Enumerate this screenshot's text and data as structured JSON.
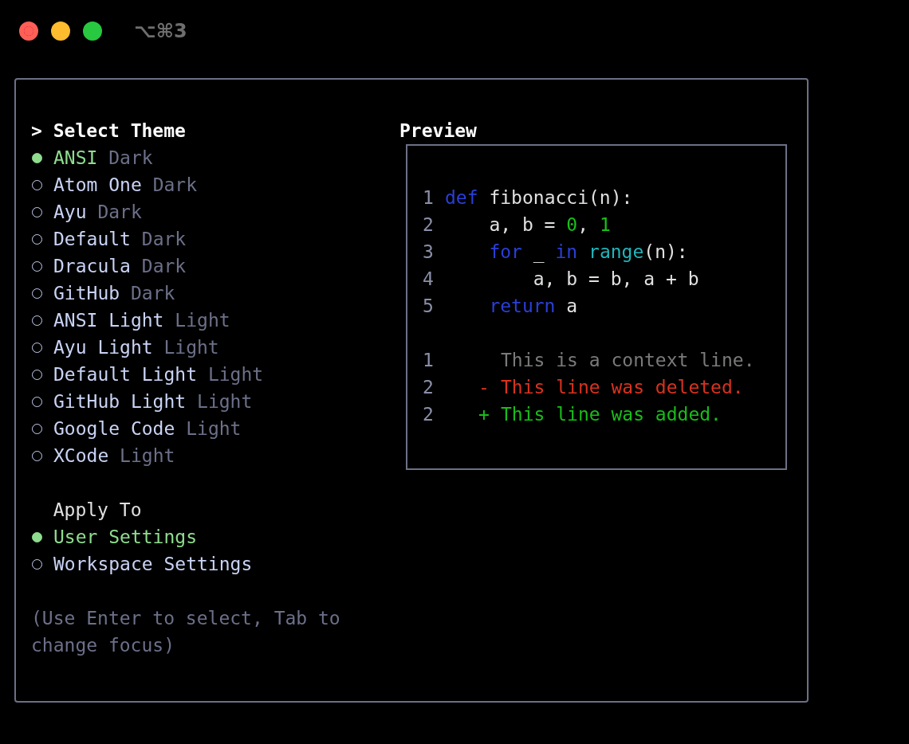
{
  "window": {
    "title": "⌥⌘3"
  },
  "theme_section": {
    "marker": ">",
    "title": "Select Theme",
    "items": [
      {
        "name": "ANSI",
        "variant": "Dark",
        "selected": true
      },
      {
        "name": "Atom One",
        "variant": "Dark",
        "selected": false
      },
      {
        "name": "Ayu",
        "variant": "Dark",
        "selected": false
      },
      {
        "name": "Default",
        "variant": "Dark",
        "selected": false
      },
      {
        "name": "Dracula",
        "variant": "Dark",
        "selected": false
      },
      {
        "name": "GitHub",
        "variant": "Dark",
        "selected": false
      },
      {
        "name": "ANSI Light",
        "variant": "Light",
        "selected": false
      },
      {
        "name": "Ayu Light",
        "variant": "Light",
        "selected": false
      },
      {
        "name": "Default Light",
        "variant": "Light",
        "selected": false
      },
      {
        "name": "GitHub Light",
        "variant": "Light",
        "selected": false
      },
      {
        "name": "Google Code",
        "variant": "Light",
        "selected": false
      },
      {
        "name": "XCode",
        "variant": "Light",
        "selected": false
      }
    ]
  },
  "apply_section": {
    "title": "Apply To",
    "items": [
      {
        "name": "User Settings",
        "selected": true
      },
      {
        "name": "Workspace Settings",
        "selected": false
      }
    ]
  },
  "hint": "(Use Enter to select, Tab to change focus)",
  "preview": {
    "title": "Preview",
    "code_lines": [
      {
        "number": "1",
        "tokens": [
          {
            "text": "def",
            "kind": "keyword"
          },
          {
            "text": " fibonacci(n):",
            "kind": "plain"
          }
        ]
      },
      {
        "number": "2",
        "tokens": [
          {
            "text": "    a, b = ",
            "kind": "plain"
          },
          {
            "text": "0",
            "kind": "number"
          },
          {
            "text": ", ",
            "kind": "plain"
          },
          {
            "text": "1",
            "kind": "number"
          }
        ]
      },
      {
        "number": "3",
        "tokens": [
          {
            "text": "    for",
            "kind": "keyword"
          },
          {
            "text": " _ ",
            "kind": "plain"
          },
          {
            "text": "in ",
            "kind": "keyword"
          },
          {
            "text": "range",
            "kind": "builtin"
          },
          {
            "text": "(n):",
            "kind": "plain"
          }
        ]
      },
      {
        "number": "4",
        "tokens": [
          {
            "text": "        a, b = b, a + b",
            "kind": "plain"
          }
        ]
      },
      {
        "number": "5",
        "tokens": [
          {
            "text": "    return",
            "kind": "keyword"
          },
          {
            "text": " a",
            "kind": "plain"
          }
        ]
      }
    ],
    "diff_lines": [
      {
        "number": "1",
        "kind": "context",
        "text": "This is a context line."
      },
      {
        "number": "2",
        "kind": "deleted",
        "sign": "-",
        "text": "This line was deleted."
      },
      {
        "number": "2",
        "kind": "added",
        "sign": "+",
        "text": "This line was added."
      }
    ]
  }
}
